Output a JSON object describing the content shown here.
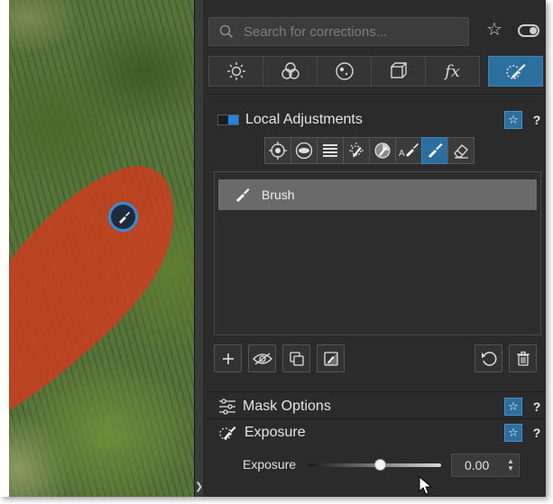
{
  "search": {
    "placeholder": "Search for corrections..."
  },
  "icons": {
    "search": "magnifier-icon",
    "favorite": "star-icon",
    "toggle": "toggle-icon",
    "help": "question-mark"
  },
  "tabs": [
    {
      "icon": "sun-icon",
      "active": false
    },
    {
      "icon": "color-circles-icon",
      "active": false
    },
    {
      "icon": "lens-circle-icon",
      "active": false
    },
    {
      "icon": "cube-icon",
      "active": false
    },
    {
      "icon": "fx-icon",
      "label": "fx",
      "active": false
    },
    {
      "icon": "local-brush-icon",
      "active": true
    }
  ],
  "local_adjustments": {
    "title": "Local Adjustments",
    "help": "?",
    "tools": [
      {
        "icon": "control-point-icon",
        "active": false
      },
      {
        "icon": "radial-filter-icon",
        "active": false
      },
      {
        "icon": "graduated-filter-icon",
        "active": false
      },
      {
        "icon": "auto-mask-icon",
        "active": false
      },
      {
        "icon": "color-picker-icon",
        "active": false
      },
      {
        "icon": "auto-brush-icon",
        "label": "A",
        "active": false
      },
      {
        "icon": "brush-icon",
        "active": true
      },
      {
        "icon": "eraser-icon",
        "active": false
      }
    ],
    "items": [
      {
        "label": "Brush",
        "selected": true
      }
    ]
  },
  "mask_options": {
    "title": "Mask Options",
    "help": "?"
  },
  "exposure": {
    "title": "Exposure",
    "help": "?",
    "slider_label": "Exposure",
    "value": "0.00",
    "slider_fraction": 0.5
  },
  "colors": {
    "accent": "#2b6f9f",
    "panel": "#2b2b2b",
    "mask": "#d23a1e"
  }
}
